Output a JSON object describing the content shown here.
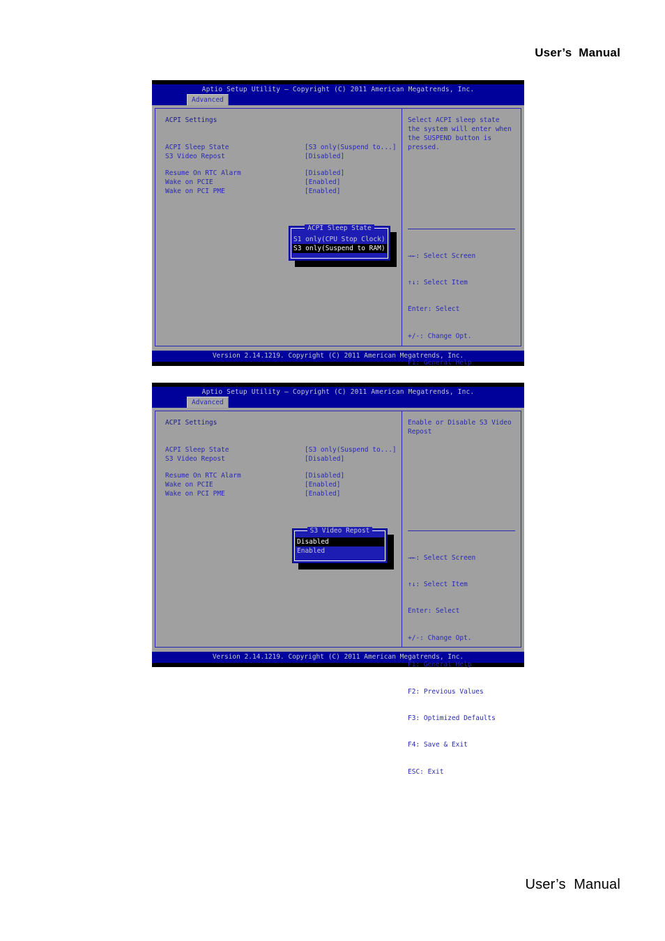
{
  "page": {
    "header_label": "User’s  Manual",
    "footer_label": "User’s  Manual"
  },
  "bios_common": {
    "title": "Aptio Setup Utility – Copyright (C) 2011 American Megatrends, Inc.",
    "tab_label": "Advanced",
    "section_title": "ACPI Settings",
    "version_footer": "Version 2.14.1219. Copyright (C) 2011 American Megatrends, Inc.",
    "legend": [
      "→←: Select Screen",
      "↑↓: Select Item",
      "Enter: Select",
      "+/-: Change Opt.",
      "F1: General Help",
      "F2: Previous Values",
      "F3: Optimized Defaults",
      "F4: Save & Exit",
      "ESC: Exit"
    ],
    "settings_group_a": [
      {
        "label": "ACPI Sleep State",
        "value": "[S3 only(Suspend to...]"
      },
      {
        "label": "S3 Video Repost",
        "value": "[Disabled]"
      }
    ],
    "settings_group_b": [
      {
        "label": "Resume On RTC Alarm",
        "value": "[Disabled]"
      },
      {
        "label": "Wake on PCIE",
        "value": "[Enabled]"
      },
      {
        "label": "Wake on PCI PME",
        "value": "[Enabled]"
      }
    ],
    "colors": {
      "titlebar": "#00009b",
      "panel_bg": "#a0a0a0",
      "text_blue": "#2828b4",
      "popup_bg": "#1d1db4",
      "selection_bg": "#000000"
    }
  },
  "screen_1": {
    "help_text": "Select ACPI sleep state the system will enter when the SUSPEND button is pressed.",
    "popup": {
      "title": "ACPI Sleep State",
      "options": [
        {
          "label": "S1 only(CPU Stop Clock)",
          "selected": false
        },
        {
          "label": "S3 only(Suspend to RAM)",
          "selected": true
        }
      ]
    }
  },
  "screen_2": {
    "help_text": "Enable or Disable S3 Video Repost",
    "popup": {
      "title": "S3 Video Repost",
      "options": [
        {
          "label": "Disabled",
          "selected": true
        },
        {
          "label": "Enabled",
          "selected": false
        }
      ]
    }
  }
}
